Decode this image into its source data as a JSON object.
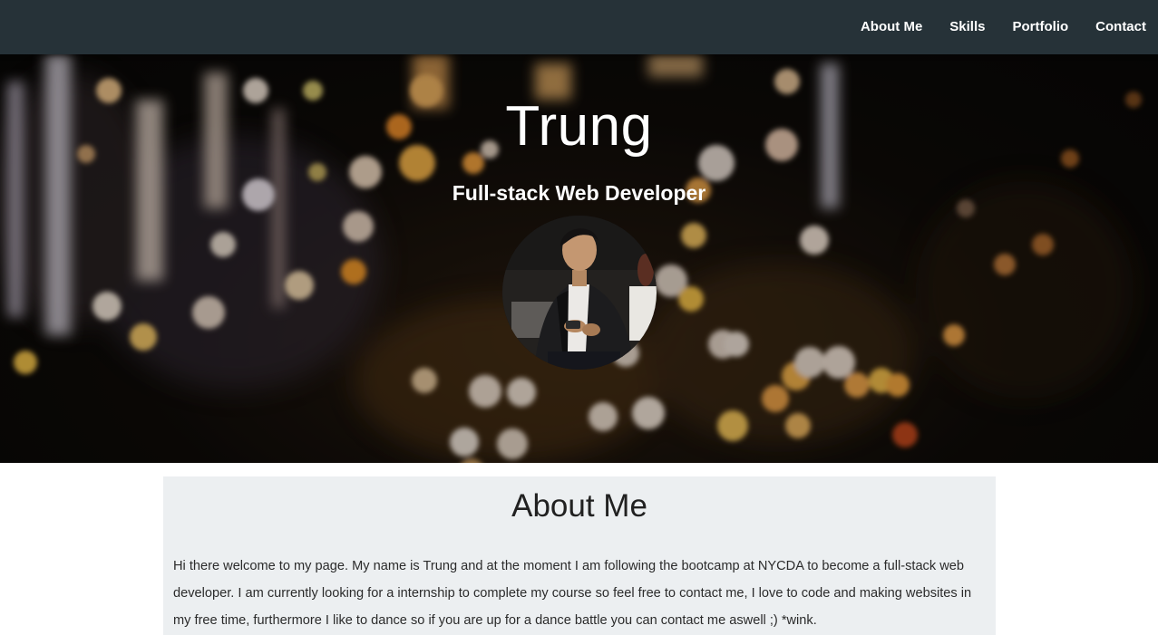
{
  "nav": {
    "items": [
      {
        "label": "About Me"
      },
      {
        "label": "Skills"
      },
      {
        "label": "Portfolio"
      },
      {
        "label": "Contact"
      }
    ]
  },
  "hero": {
    "name": "Trung",
    "role": "Full-stack Web Developer"
  },
  "about": {
    "title": "About Me",
    "text": "Hi there welcome to my page. My name is Trung and at the moment I am following the bootcamp at NYCDA to become a full-stack web developer. I am currently looking for a internship to complete my course so feel free to contact me, I love to code and making websites in my free time, furthermore I like to dance so if you are up for a dance battle you can contact me aswell ;) *wink."
  },
  "colors": {
    "navbar": "#263238",
    "about_bg": "#eceff1",
    "text_light": "#ffffff",
    "text_dark": "#212121"
  }
}
